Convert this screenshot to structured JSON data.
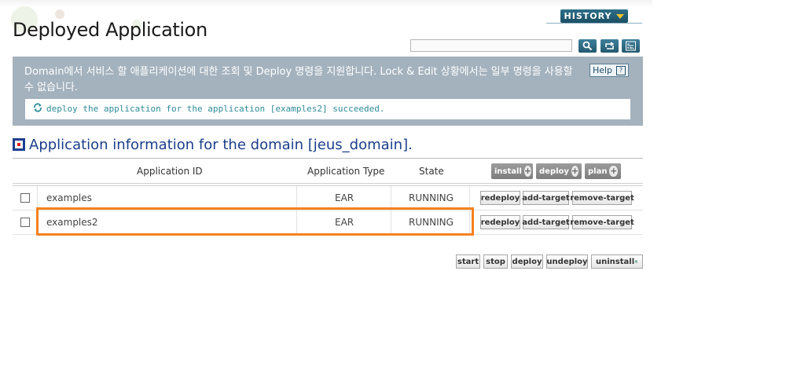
{
  "header": {
    "title": "Deployed Application",
    "history_label": "HISTORY",
    "search_value": ""
  },
  "info": {
    "description": "Domain에서 서비스 할 애플리케이션에 대한 조회 및 Deploy 명령을 지원합니다. Lock & Edit 상황에서는 일부 명령을 사용할 수 없습니다.",
    "help_label": "Help",
    "message": "deploy the application for the application [examples2] succeeded."
  },
  "section": {
    "title": "Application information for the domain [jeus_domain]."
  },
  "table": {
    "columns": [
      "Application ID",
      "Application Type",
      "State"
    ],
    "header_actions": [
      "install",
      "deploy",
      "plan"
    ],
    "rows": [
      {
        "id": "examples",
        "type": "EAR",
        "state": "RUNNING"
      },
      {
        "id": "examples2",
        "type": "EAR",
        "state": "RUNNING"
      }
    ],
    "row_actions": [
      "redeploy",
      "add-target",
      "remove-target"
    ]
  },
  "bottom_actions": [
    "start",
    "stop",
    "deploy",
    "undeploy",
    "uninstall"
  ],
  "colors": {
    "accent": "#1b3e8a",
    "info_bg": "#a4b2bd",
    "highlight": "#f5821f"
  }
}
